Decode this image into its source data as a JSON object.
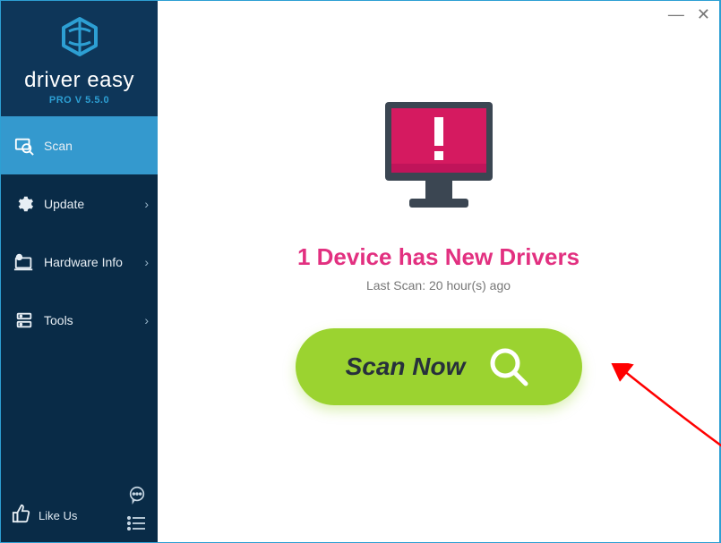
{
  "brand": {
    "name": "driver easy",
    "version": "PRO V 5.5.0"
  },
  "sidebar": {
    "items": [
      {
        "label": "Scan",
        "active": true
      },
      {
        "label": "Update",
        "active": false
      },
      {
        "label": "Hardware Info",
        "active": false
      },
      {
        "label": "Tools",
        "active": false
      }
    ],
    "likeUs": "Like Us"
  },
  "main": {
    "headline": "1 Device has New Drivers",
    "lastScan": "Last Scan: 20 hour(s) ago",
    "scanButton": "Scan Now"
  },
  "colors": {
    "accent": "#3499ce",
    "sidebarBg": "#092b47",
    "headerBg": "#0e3659",
    "alert": "#e23080",
    "scanBtn": "#9bd330"
  }
}
